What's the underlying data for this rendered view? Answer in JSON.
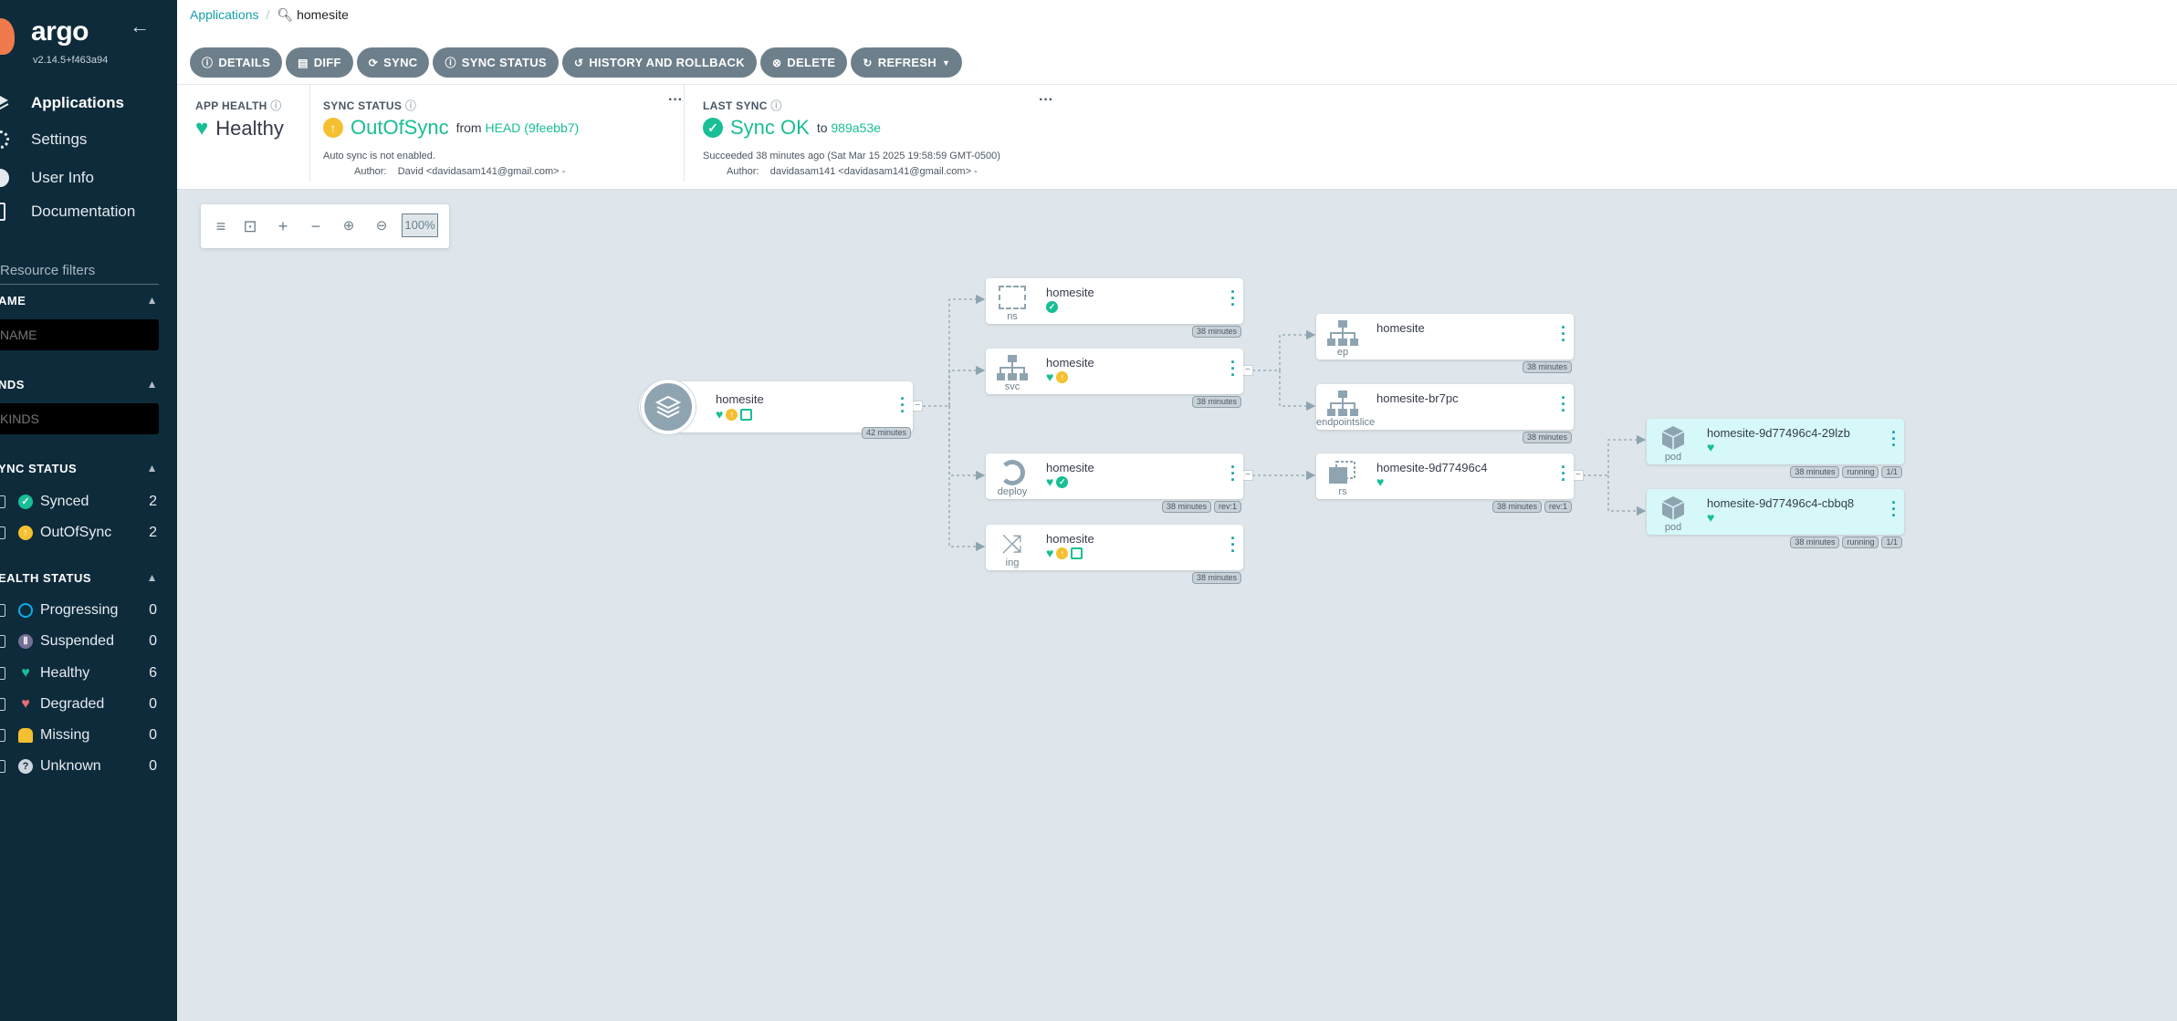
{
  "sidebar": {
    "logo_text": "argo",
    "version": "v2.14.5+f463a94",
    "nav": [
      {
        "label": "Applications"
      },
      {
        "label": "Settings"
      },
      {
        "label": "User Info"
      },
      {
        "label": "Documentation"
      }
    ],
    "resource_filters_title": "Resource filters",
    "name_filter": {
      "title": "AME",
      "placeholder": "NAME"
    },
    "kinds_filter": {
      "title": "NDS",
      "placeholder": "KINDS"
    },
    "sync_status": {
      "title": "YNC STATUS",
      "items": [
        {
          "label": "Synced",
          "count": "2"
        },
        {
          "label": "OutOfSync",
          "count": "2"
        }
      ]
    },
    "health_status": {
      "title": "EALTH STATUS",
      "items": [
        {
          "label": "Progressing",
          "count": "0"
        },
        {
          "label": "Suspended",
          "count": "0"
        },
        {
          "label": "Healthy",
          "count": "6"
        },
        {
          "label": "Degraded",
          "count": "0"
        },
        {
          "label": "Missing",
          "count": "0"
        },
        {
          "label": "Unknown",
          "count": "0"
        }
      ]
    }
  },
  "breadcrumb": {
    "root": "Applications",
    "current": "homesite"
  },
  "toolbar": [
    {
      "label": "DETAILS"
    },
    {
      "label": "DIFF"
    },
    {
      "label": "SYNC"
    },
    {
      "label": "SYNC STATUS"
    },
    {
      "label": "HISTORY AND ROLLBACK"
    },
    {
      "label": "DELETE"
    },
    {
      "label": "REFRESH"
    }
  ],
  "summary": {
    "app_health": {
      "title": "APP HEALTH",
      "value": "Healthy"
    },
    "sync_status": {
      "title": "SYNC STATUS",
      "value": "OutOfSync",
      "from_label": "from",
      "revision": "HEAD (9feebb7)",
      "auto_sync": "Auto sync is not enabled.",
      "author_label": "Author:",
      "author": "David <davidasam141@gmail.com> -"
    },
    "last_sync": {
      "title": "LAST SYNC",
      "value": "Sync OK",
      "to_label": "to",
      "revision": "989a53e",
      "succeeded": "Succeeded 38 minutes ago (Sat Mar 15 2025 19:58:59 GMT-0500)",
      "author_label": "Author:",
      "author": "davidasam141 <davidasam141@gmail.com> -"
    }
  },
  "graph": {
    "zoom": "100%",
    "app": {
      "name": "homesite",
      "age": "42 minutes"
    },
    "nodes": [
      {
        "id": "ns",
        "name": "homesite",
        "kind": "ns",
        "tags": [
          "38 minutes"
        ]
      },
      {
        "id": "svc",
        "name": "homesite",
        "kind": "svc",
        "tags": [
          "38 minutes"
        ]
      },
      {
        "id": "deploy",
        "name": "homesite",
        "kind": "deploy",
        "tags": [
          "38 minutes",
          "rev:1"
        ]
      },
      {
        "id": "ing",
        "name": "homesite",
        "kind": "ing",
        "tags": [
          "38 minutes"
        ]
      },
      {
        "id": "ep",
        "name": "homesite",
        "kind": "ep",
        "tags": [
          "38 minutes"
        ]
      },
      {
        "id": "eps",
        "name": "homesite-br7pc",
        "kind": "endpointslice",
        "tags": [
          "38 minutes"
        ]
      },
      {
        "id": "rs",
        "name": "homesite-9d77496c4",
        "kind": "rs",
        "tags": [
          "38 minutes",
          "rev:1"
        ]
      },
      {
        "id": "pod1",
        "name": "homesite-9d77496c4-29lzb",
        "kind": "pod",
        "tags": [
          "38 minutes",
          "running",
          "1/1"
        ]
      },
      {
        "id": "pod2",
        "name": "homesite-9d77496c4-cbbq8",
        "kind": "pod",
        "tags": [
          "38 minutes",
          "running",
          "1/1"
        ]
      }
    ]
  },
  "colors": {
    "sidebar_bg": "#0e2b3b",
    "accent": "#18be94",
    "outofsync": "#f4c030",
    "link": "#15a0ad",
    "button": "#6d7f8b"
  }
}
